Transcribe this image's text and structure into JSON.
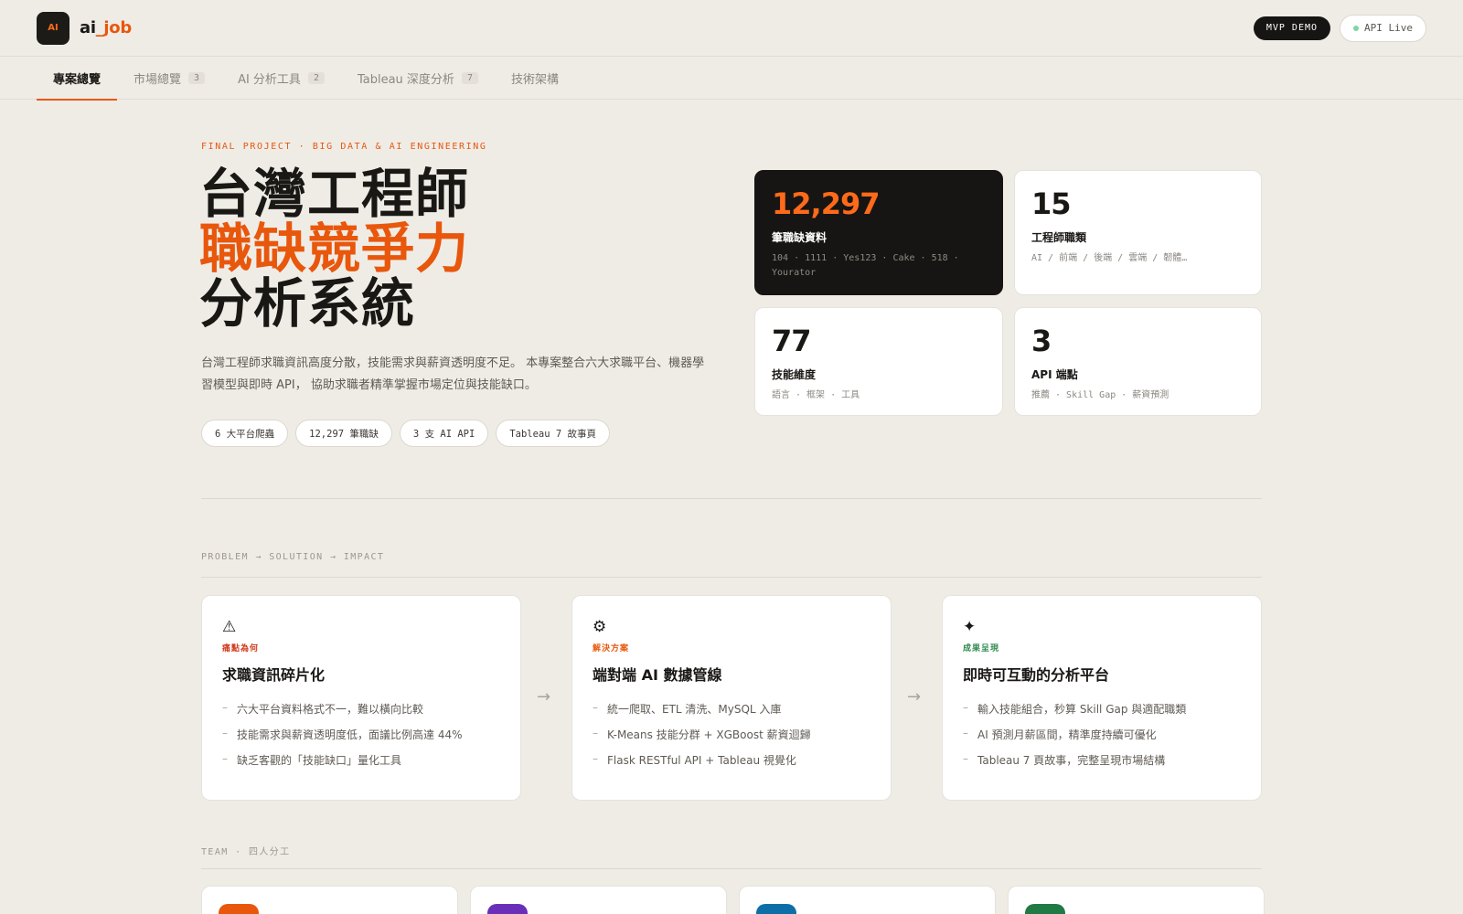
{
  "header": {
    "logo_text": "AI",
    "brand_main": "ai",
    "brand_accent": "_job",
    "demo_label": "MVP DEMO",
    "api_label": "API Live"
  },
  "tabs": [
    {
      "label": "專案總覽",
      "count": "",
      "active": true
    },
    {
      "label": "市場總覽",
      "count": "3"
    },
    {
      "label": "AI 分析工具",
      "count": "2"
    },
    {
      "label": "Tableau 深度分析",
      "count": "7"
    },
    {
      "label": "技術架構",
      "count": ""
    }
  ],
  "hero": {
    "eyebrow": "FINAL PROJECT · BIG DATA & AI ENGINEERING",
    "title_line1": "台灣工程師",
    "title_line2": "職缺競爭力",
    "title_line3": "分析系統",
    "description": "台灣工程師求職資訊高度分散，技能需求與薪資透明度不足。 本專案整合六大求職平台、機器學習模型與即時 API， 協助求職者精準掌握市場定位與技能缺口。",
    "chips": [
      "6 大平台爬蟲",
      "12,297 筆職缺",
      "3 支 AI API",
      "Tableau 7 故事頁"
    ]
  },
  "stats": [
    {
      "value": "12,297",
      "label": "筆職缺資料",
      "sub": "104 · 1111 · Yes123 · Cake · 518 · Yourator"
    },
    {
      "value": "15",
      "label": "工程師職類",
      "sub": "AI / 前端 / 後端 / 雲端 / 韌體…"
    },
    {
      "value": "77",
      "label": "技能維度",
      "sub": "語言 · 框架 · 工具"
    },
    {
      "value": "3",
      "label": "API 端點",
      "sub": "推薦 · Skill Gap · 薪資預測"
    }
  ],
  "psi_section_label": "PROBLEM → SOLUTION → IMPACT",
  "psi": [
    {
      "icon": "⚠",
      "icon_name": "warning-icon",
      "tag": "痛點為何",
      "tag_color": "#d03a1c",
      "title": "求職資訊碎片化",
      "items": [
        "六大平台資料格式不一，難以橫向比較",
        "技能需求與薪資透明度低，面議比例高達 44%",
        "缺乏客觀的「技能缺口」量化工具"
      ]
    },
    {
      "icon": "⚙",
      "icon_name": "gear-icon",
      "tag": "解決方案",
      "tag_color": "#e8570c",
      "title": "端對端 AI 數據管線",
      "items": [
        "統一爬取、ETL 清洗、MySQL 入庫",
        "K-Means 技能分群 + XGBoost 薪資迴歸",
        "Flask RESTful API + Tableau 視覺化"
      ]
    },
    {
      "icon": "✦",
      "icon_name": "sparkle-icon",
      "tag": "成果呈現",
      "tag_color": "#2f8a4e",
      "title": "即時可互動的分析平台",
      "items": [
        "輸入技能組合，秒算 Skill Gap 與適配職類",
        "AI 預測月薪區間，精準度持續可優化",
        "Tableau 7 頁故事，完整呈現市場結構"
      ]
    }
  ],
  "arrow_glyph": "→",
  "team_section_label": "TEAM · 四人分工",
  "team_colors": [
    "#e8570c",
    "#6a2fb8",
    "#0e6fa8",
    "#1f7a44"
  ]
}
